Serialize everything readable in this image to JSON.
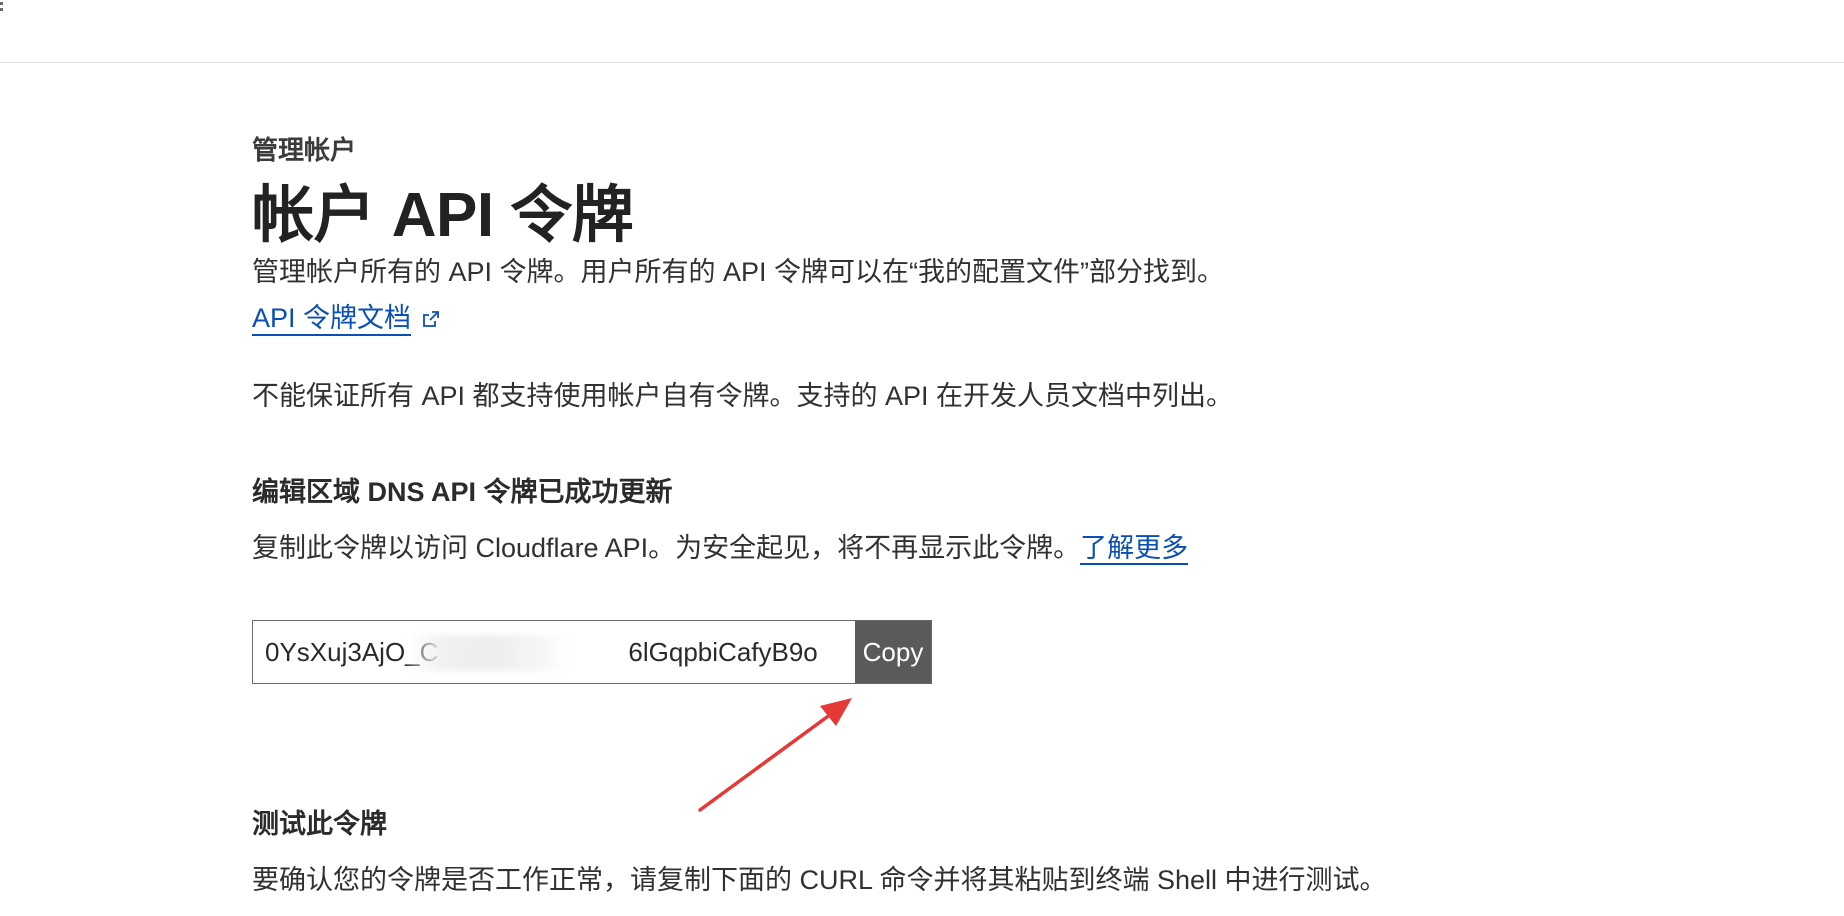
{
  "header": {
    "eyebrow": "管理帐户",
    "title": "帐户 API 令牌",
    "description": "管理帐户所有的 API 令牌。用户所有的 API 令牌可以在“我的配置文件”部分找到。",
    "doc_link_label": "API 令牌文档"
  },
  "notice": "不能保证所有 API 都支持使用帐户自有令牌。支持的 API 在开发人员文档中列出。",
  "success": {
    "heading": "编辑区域 DNS API 令牌已成功更新",
    "hint": "复制此令牌以访问 Cloudflare API。为安全起见，将不再显示此令牌。",
    "learn_more": "了解更多",
    "token_prefix": "0YsXuj3AjO_C",
    "token_suffix": "6lGqpbiCafyB9o",
    "copy_label": "Copy"
  },
  "test": {
    "heading": "测试此令牌",
    "description": "要确认您的令牌是否工作正常，请复制下面的 CURL 命令并将其粘贴到终端 Shell 中进行测试。"
  },
  "colors": {
    "link": "#0a4fb5",
    "copy_button_bg": "#5a5a5a",
    "annotation_arrow": "#e53935"
  },
  "icons": {
    "external_link": "external-link-icon",
    "menu": "menu-dots-icon",
    "annotation": "red-arrow-annotation"
  }
}
